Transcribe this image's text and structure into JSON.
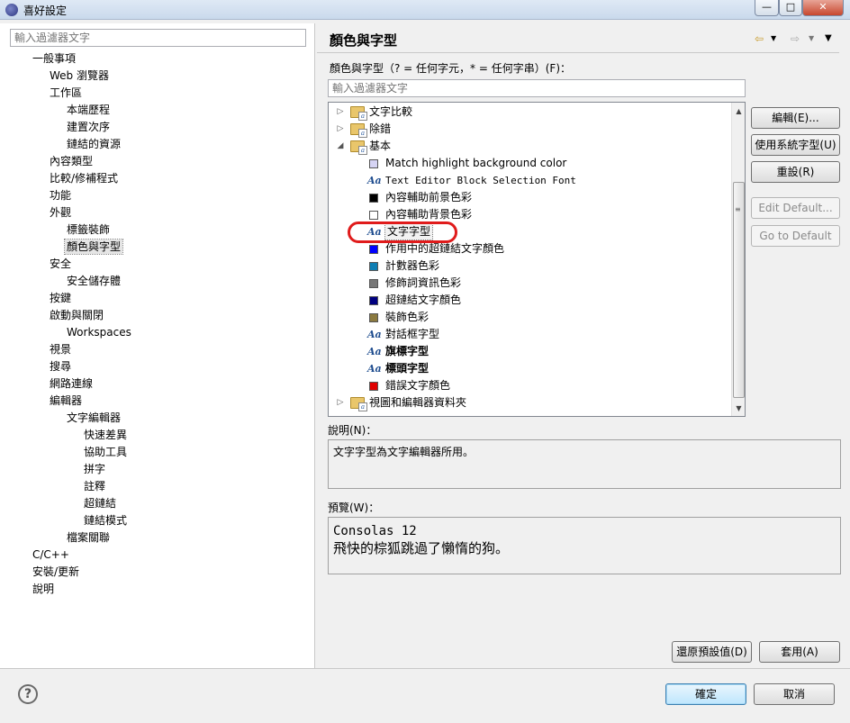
{
  "window": {
    "title": "喜好設定",
    "controls": [
      "—",
      "□",
      "✕"
    ]
  },
  "left": {
    "filter_placeholder": "輸入過濾器文字",
    "tree": [
      {
        "label": "一般事項",
        "level": 1
      },
      {
        "label": "Web 瀏覽器",
        "level": 2
      },
      {
        "label": "工作區",
        "level": 2
      },
      {
        "label": "本端歷程",
        "level": 3
      },
      {
        "label": "建置次序",
        "level": 3
      },
      {
        "label": "鏈結的資源",
        "level": 3
      },
      {
        "label": "內容類型",
        "level": 2
      },
      {
        "label": "比較/修補程式",
        "level": 2
      },
      {
        "label": "功能",
        "level": 2
      },
      {
        "label": "外觀",
        "level": 2
      },
      {
        "label": "標籤裝飾",
        "level": 3
      },
      {
        "label": "顏色與字型",
        "level": 3,
        "selected": true
      },
      {
        "label": "安全",
        "level": 2
      },
      {
        "label": "安全儲存體",
        "level": 3
      },
      {
        "label": "按鍵",
        "level": 2
      },
      {
        "label": "啟動與關閉",
        "level": 2
      },
      {
        "label": "Workspaces",
        "level": 3
      },
      {
        "label": "視景",
        "level": 2
      },
      {
        "label": "搜尋",
        "level": 2
      },
      {
        "label": "網路連線",
        "level": 2
      },
      {
        "label": "編輯器",
        "level": 2
      },
      {
        "label": "文字編輯器",
        "level": 3
      },
      {
        "label": "快速差異",
        "level": 4
      },
      {
        "label": "協助工具",
        "level": 4
      },
      {
        "label": "拼字",
        "level": 4
      },
      {
        "label": "註釋",
        "level": 4
      },
      {
        "label": "超鏈結",
        "level": 4
      },
      {
        "label": "鏈結模式",
        "level": 4
      },
      {
        "label": "檔案關聯",
        "level": 3
      },
      {
        "label": "C/C++",
        "level": 1
      },
      {
        "label": "安裝/更新",
        "level": 1
      },
      {
        "label": "說明",
        "level": 1
      }
    ]
  },
  "right": {
    "title": "顏色與字型",
    "list_label": "顏色與字型（? = 任何字元，* = 任何字串）(F)：",
    "filter_placeholder": "輸入過濾器文字",
    "items": [
      {
        "label": "文字比較",
        "kind": "category",
        "expanded": false,
        "indent": 0
      },
      {
        "label": "除錯",
        "kind": "category",
        "expanded": false,
        "indent": 0
      },
      {
        "label": "基本",
        "kind": "category",
        "expanded": true,
        "indent": 0
      },
      {
        "label": "Match highlight background color",
        "kind": "color",
        "color": "#d6d4f4",
        "indent": 1
      },
      {
        "label": "Text Editor Block Selection Font",
        "kind": "font",
        "mono": true,
        "indent": 1
      },
      {
        "label": "內容輔助前景色彩",
        "kind": "color",
        "color": "#000000",
        "indent": 1
      },
      {
        "label": "內容輔助背景色彩",
        "kind": "color",
        "color": "#ffffff",
        "indent": 1
      },
      {
        "label": "文字字型",
        "kind": "font",
        "indent": 1,
        "selected": true
      },
      {
        "label": "作用中的超鏈結文字顏色",
        "kind": "color",
        "color": "#0000ff",
        "indent": 1
      },
      {
        "label": "計數器色彩",
        "kind": "color",
        "color": "#0f7fb4",
        "indent": 1
      },
      {
        "label": "修飾詞資訊色彩",
        "kind": "color",
        "color": "#777777",
        "indent": 1
      },
      {
        "label": "超鏈結文字顏色",
        "kind": "color",
        "color": "#000080",
        "indent": 1
      },
      {
        "label": "裝飾色彩",
        "kind": "color",
        "color": "#8b7a40",
        "indent": 1
      },
      {
        "label": "對話框字型",
        "kind": "font",
        "indent": 1
      },
      {
        "label": "旗標字型",
        "kind": "font",
        "bold": true,
        "indent": 1
      },
      {
        "label": "標頭字型",
        "kind": "font",
        "bold": true,
        "indent": 1
      },
      {
        "label": "錯誤文字顏色",
        "kind": "color",
        "color": "#e00000",
        "indent": 1
      },
      {
        "label": "視圖和編輯器資料夾",
        "kind": "category",
        "expanded": false,
        "indent": 0
      }
    ],
    "buttons": {
      "edit": "編輯(E)...",
      "use_system_font": "使用系統字型(U)",
      "reset": "重設(R)",
      "edit_default": "Edit Default...",
      "go_to_default": "Go to Default"
    },
    "description_label": "說明(N)：",
    "description_text": "文字字型為文字編輯器所用。",
    "preview_label": "預覽(W)：",
    "preview_line1": "Consolas 12",
    "preview_line2": "飛快的棕狐跳過了懶惰的狗。",
    "restore_defaults": "還原預設值(D)",
    "apply": "套用(A)"
  },
  "footer": {
    "ok": "確定",
    "cancel": "取消",
    "help": "?"
  },
  "glyphs": {
    "font_item": "Aa",
    "expand_closed": "▷",
    "expand_open": "◢",
    "grip": "≡"
  }
}
